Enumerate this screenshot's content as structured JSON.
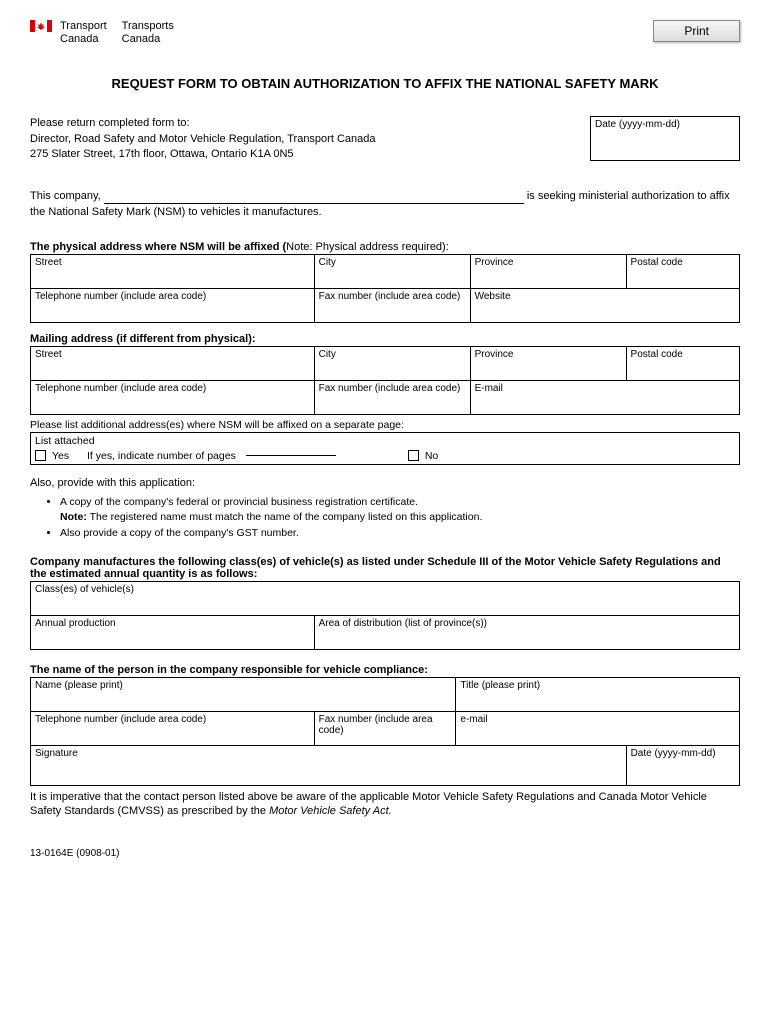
{
  "header": {
    "dept_en_line1": "Transport",
    "dept_en_line2": "Canada",
    "dept_fr_line1": "Transports",
    "dept_fr_line2": "Canada",
    "print_label": "Print"
  },
  "title": "REQUEST FORM TO OBTAIN AUTHORIZATION TO AFFIX THE NATIONAL SAFETY MARK",
  "return_to": {
    "line1": "Please return completed form to:",
    "line2": "Director, Road Safety and Motor Vehicle Regulation, Transport Canada",
    "line3": "275 Slater Street, 17th floor, Ottawa, Ontario  K1A 0N5"
  },
  "date_label": "Date (yyyy-mm-dd)",
  "company_sentence": {
    "prefix": "This company, ",
    "suffix": " is seeking ministerial authorization to affix",
    "line2": "the National Safety Mark (NSM) to vehicles it manufactures."
  },
  "physical": {
    "heading_bold": "The physical address where NSM will be affixed (",
    "heading_note": "Note: Physical address required):",
    "street": "Street",
    "city": "City",
    "province": "Province",
    "postal": "Postal code",
    "telephone": "Telephone number (include area code)",
    "fax": "Fax number (include area code)",
    "website": "Website"
  },
  "mailing": {
    "heading": "Mailing address (if different from physical):",
    "street": "Street",
    "city": "City",
    "province": "Province",
    "postal": "Postal code",
    "telephone": "Telephone number (include area code)",
    "fax": "Fax number (include area code)",
    "email": "E-mail"
  },
  "additional_line": "Please list additional address(es) where NSM will be affixed on a separate page:",
  "list_attached": {
    "label": "List attached",
    "yes": "Yes",
    "yes_text": "If yes, indicate number of pages",
    "no": "No"
  },
  "also_provide": "Also, provide with this application:",
  "bullets": {
    "b1": "A copy of the company's federal or provincial business registration certificate.",
    "b1_note_label": "Note:",
    "b1_note": " The registered name must match the name of the company listed on this application.",
    "b2": "Also provide a copy of the company's GST number."
  },
  "classes": {
    "heading1": "Company manufactures the following class(es) of vehicle(s) as listed under Schedule III of the Motor Vehicle Safety Regulations and",
    "heading2": "the estimated annual quantity is as follows:",
    "classes": "Class(es) of vehicle(s)",
    "annual": "Annual production",
    "area": "Area of distribution (list of province(s))"
  },
  "responsible": {
    "heading": "The name of the person in the company responsible for vehicle compliance:",
    "name": "Name (please print)",
    "title": "Title (please print)",
    "telephone": "Telephone number (include area code)",
    "fax": "Fax number (include area code)",
    "email": "e-mail",
    "signature": "Signature",
    "date": "Date (yyyy-mm-dd)"
  },
  "imperative": {
    "text1": "It is imperative that the contact person listed above be aware of the applicable Motor Vehicle Safety Regulations and Canada Motor Vehicle",
    "text2": "Safety Standards (CMVSS) as prescribed by the ",
    "italic": "Motor Vehicle Safety Act."
  },
  "form_number": "13-0164E (0908-01)"
}
